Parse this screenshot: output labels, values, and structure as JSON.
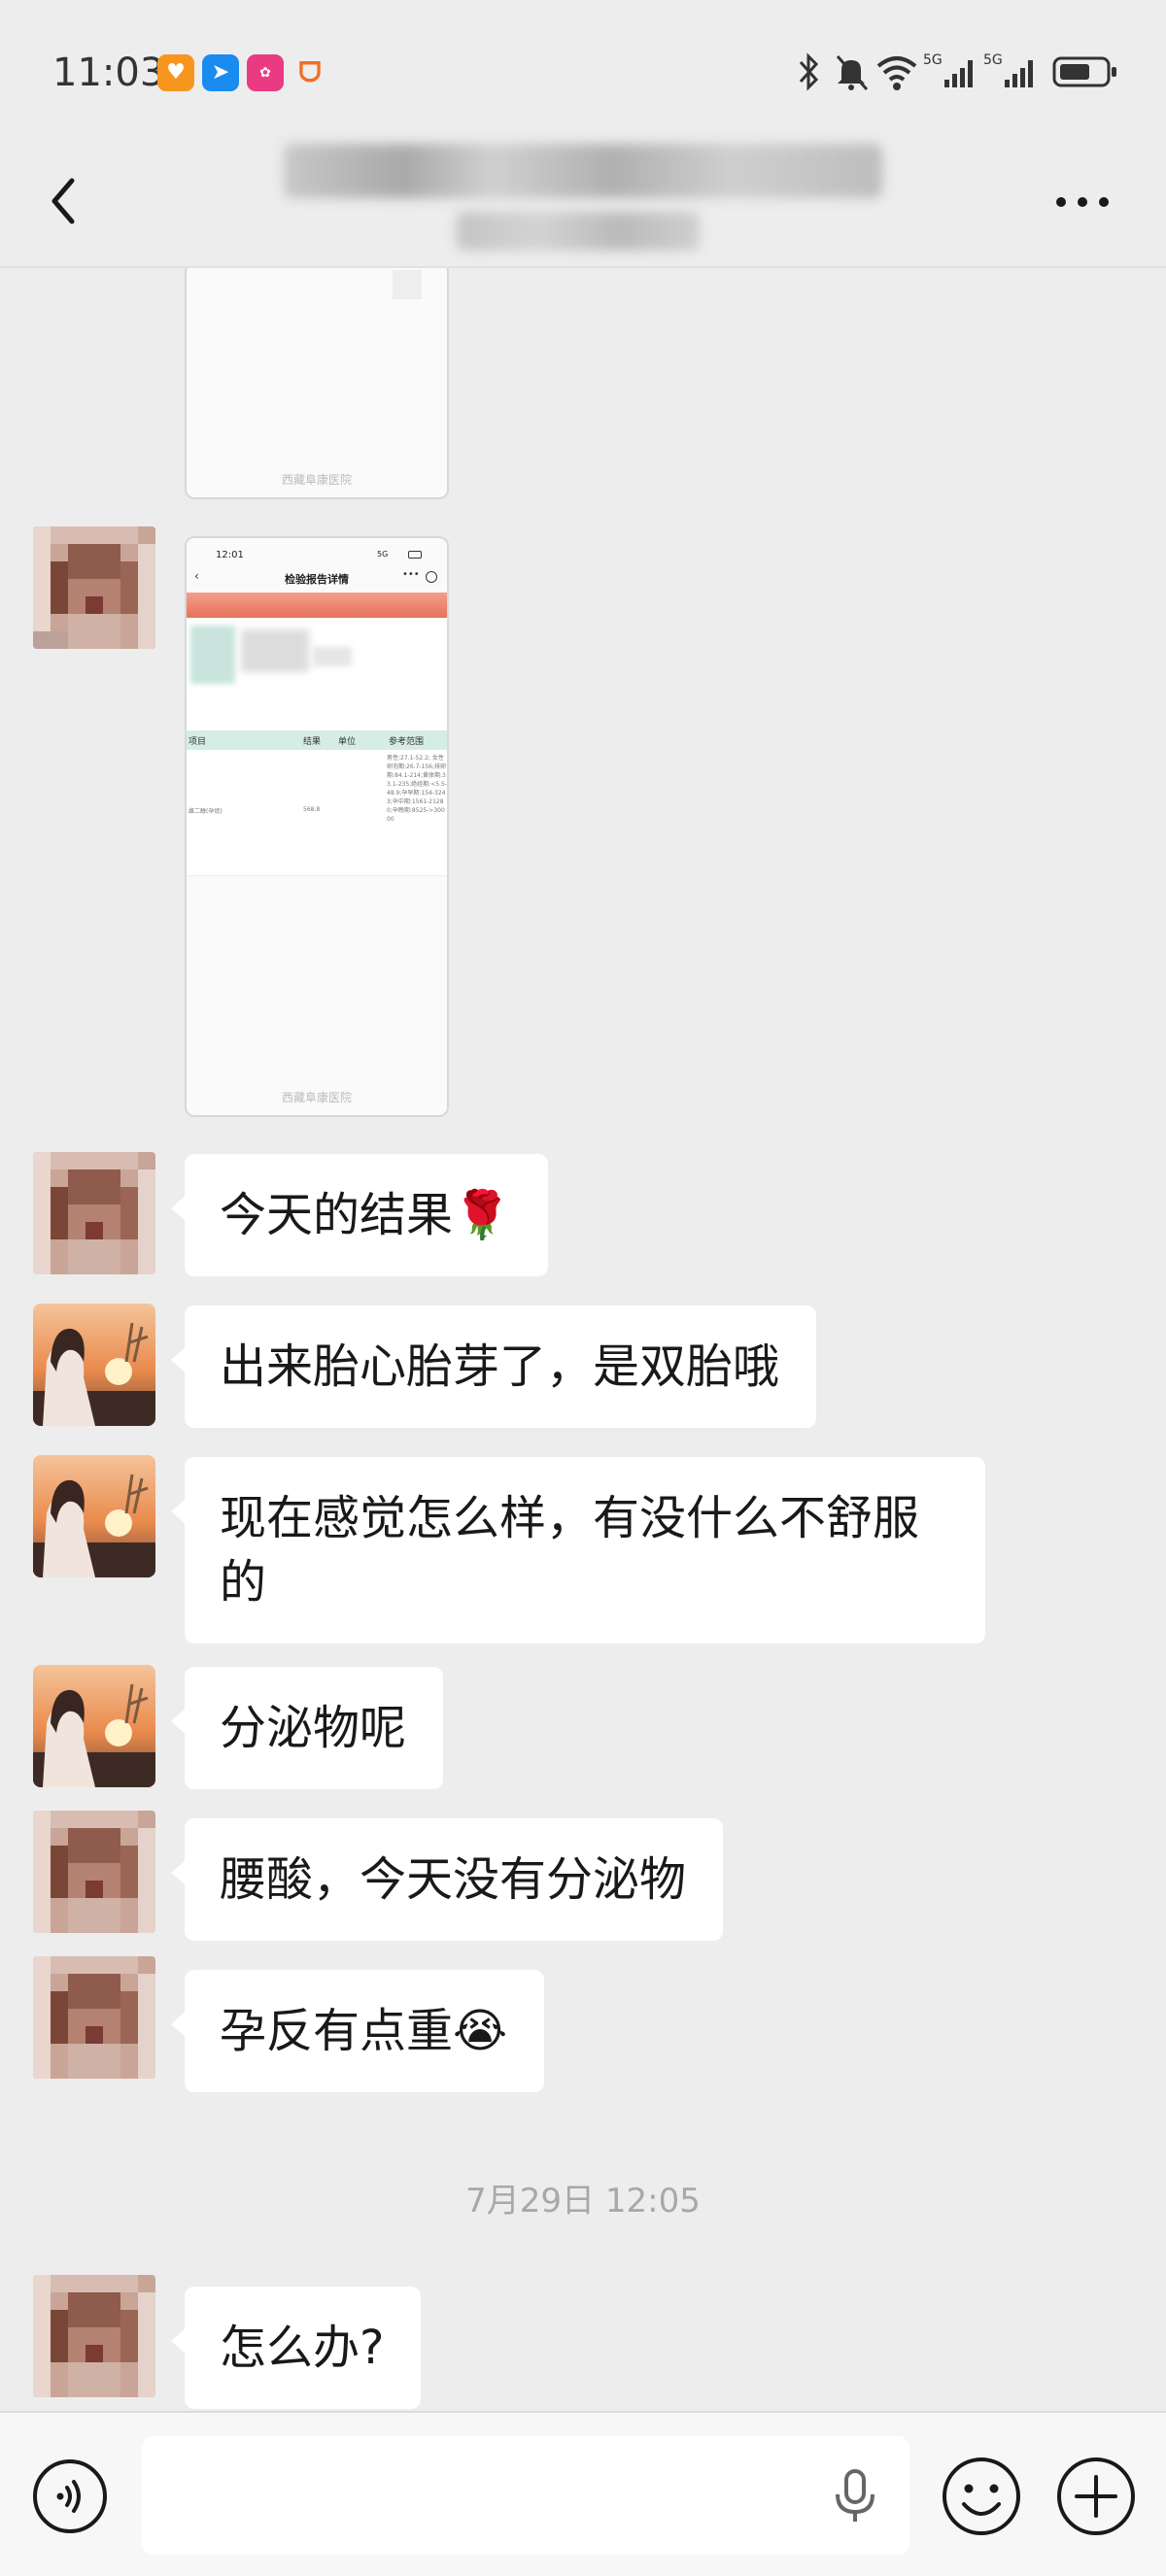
{
  "status_bar": {
    "time": "11:03",
    "network_1": "5G",
    "network_2": "5G",
    "apps": [
      "orange-app",
      "blue-app",
      "pink-app",
      "red-app"
    ]
  },
  "header": {
    "title": "",
    "subtitle": ""
  },
  "messages": [
    {
      "type": "image",
      "from": "contact-a",
      "caption": "西藏阜康医院"
    },
    {
      "type": "image",
      "from": "contact-a",
      "screenshot": {
        "time": "12:01",
        "signal": "5G",
        "title": "检验报告详情",
        "columns": [
          "项目",
          "结果",
          "单位",
          "参考范围"
        ],
        "row_item": "雌二醇(孕烷)",
        "row_value": "568.8",
        "row_range": "男性:27.1-52.2; 女性卵泡期:26.7-156;排卵期:84.1-214;黄体期:33.1-235;绝经期:<5.5-48.9;孕早期:154-3243;孕中期:1561-21280;孕晚期:8525->30000",
        "watermark": "西藏阜康医院"
      }
    },
    {
      "type": "text",
      "from": "contact-a",
      "text": "今天的结果🌹"
    },
    {
      "type": "text",
      "from": "contact-b",
      "text": "出来胎心胎芽了，是双胎哦"
    },
    {
      "type": "text",
      "from": "contact-b",
      "text": "现在感觉怎么样，有没什么不舒服的"
    },
    {
      "type": "text",
      "from": "contact-b",
      "text": "分泌物呢"
    },
    {
      "type": "text",
      "from": "contact-a",
      "text": "腰酸，今天没有分泌物"
    },
    {
      "type": "text",
      "from": "contact-a",
      "text": "孕反有点重😭"
    },
    {
      "type": "timestamp",
      "text": "7月29日 12:05"
    },
    {
      "type": "text",
      "from": "contact-a",
      "text": "怎么办?"
    }
  ],
  "input_bar": {
    "placeholder": "",
    "icons": [
      "voice-icon",
      "microphone-icon",
      "emoji-icon",
      "plus-icon"
    ]
  },
  "colors": {
    "background": "#ededed",
    "bubble": "#ffffff",
    "text": "#191919",
    "timestamp": "#a8a8a8",
    "report_header": "#e8715a",
    "report_table_header": "#d6ede6"
  }
}
